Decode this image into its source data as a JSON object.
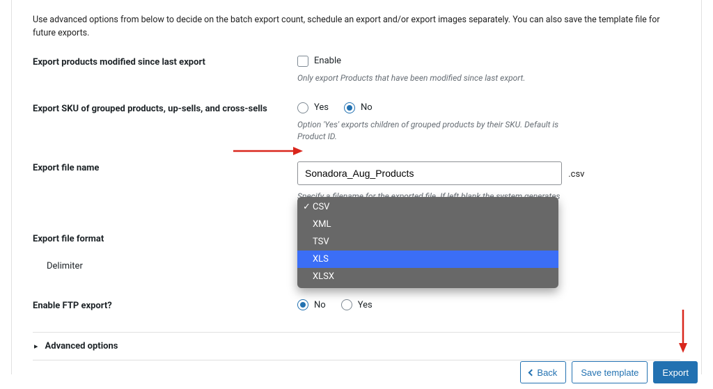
{
  "intro": "Use advanced options from below to decide on the batch export count, schedule an export and/or export images separately. You can also save the template file for future exports.",
  "fields": {
    "modified": {
      "label": "Export products modified since last export",
      "checkbox_label": "Enable",
      "hint": "Only export Products that have been modified since last export."
    },
    "sku": {
      "label": "Export SKU of grouped products, up-sells, and cross-sells",
      "yes": "Yes",
      "no": "No",
      "hint": "Option 'Yes' exports children of grouped products by their SKU. Default is Product ID."
    },
    "filename": {
      "label": "Export file name",
      "value": "Sonadora_Aug_Products",
      "suffix": ".csv",
      "hint": "Specify a filename for the exported file. If left blank the system generates a default name."
    },
    "format": {
      "label": "Export file format"
    },
    "delimiter": {
      "label": "Delimiter"
    },
    "ftp": {
      "label": "Enable FTP export?",
      "no": "No",
      "yes": "Yes"
    }
  },
  "dropdown": {
    "options": [
      "CSV",
      "XML",
      "TSV",
      "XLS",
      "XLSX"
    ],
    "selected": "CSV",
    "highlighted": "XLS"
  },
  "accordion": {
    "title": "Advanced options"
  },
  "footer": {
    "back": "Back",
    "save": "Save template",
    "export": "Export"
  }
}
